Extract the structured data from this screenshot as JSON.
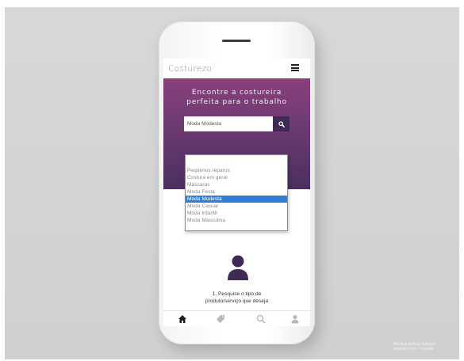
{
  "app": {
    "brand": "Costurezo"
  },
  "hero": {
    "headline_line1": "Encontre a costureira",
    "headline_line2": "perfeita para o trabalho"
  },
  "search": {
    "value": "Moda Modesta",
    "button_icon": "search-icon"
  },
  "dropdown": {
    "options": [
      "Pequenos reparos",
      "Costura em geral",
      "Máscaras",
      "Moda Festa",
      "Moda Modesta",
      "Moda Casual",
      "Moda Infantil",
      "Moda Masculina"
    ],
    "selected": "Moda Modesta"
  },
  "steps": {
    "step1_line1": "1. Pesquise o tipo de",
    "step1_line2": "produto/serviço que deseja"
  },
  "tabbar": {
    "items": [
      "home-icon",
      "tag-icon",
      "search-icon",
      "user-icon"
    ]
  },
  "credit": {
    "line1": "Mockup Iphone feito por",
    "line2": "rawpixel.com / Freepik"
  },
  "colors": {
    "hero_top": "#8a3f7c",
    "hero_bottom": "#4a2f60",
    "accent_dark": "#3e2a55",
    "selected_option": "#2f7fd6"
  }
}
